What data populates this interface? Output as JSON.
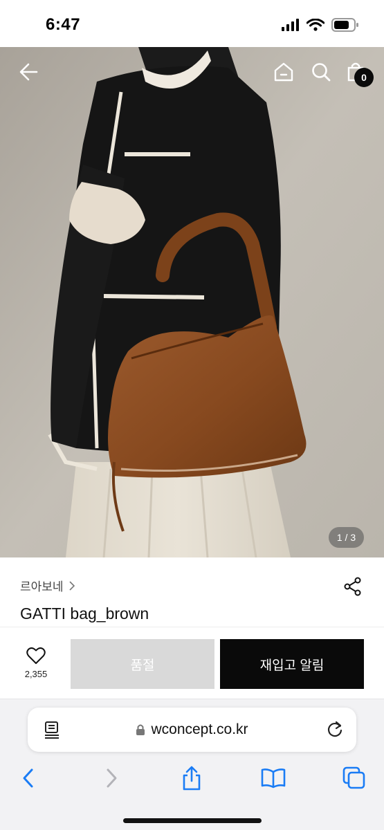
{
  "status_bar": {
    "time": "6:47"
  },
  "hero": {
    "pager": "1 / 3",
    "cart_count": "0"
  },
  "product": {
    "brand": "르아보네",
    "brand_chevron": ">",
    "title": "GATTI bag_brown"
  },
  "actions": {
    "like_count": "2,355",
    "soldout_label": "품절",
    "restock_label": "재입고 알림"
  },
  "browser": {
    "url": "wconcept.co.kr"
  },
  "colors": {
    "accent_dark": "#0a0a0a",
    "disabled_gray": "#d9d9d9",
    "ios_blue": "#1a7cf5",
    "bag_brown": "#8a4f27"
  },
  "icons": [
    "back-arrow-icon",
    "home-icon",
    "search-icon",
    "cart-icon",
    "share-icon",
    "heart-icon",
    "reader-icon",
    "lock-icon",
    "reload-icon",
    "chevron-left-icon",
    "chevron-right-icon",
    "share-up-icon",
    "bookmarks-icon",
    "tabs-icon"
  ]
}
